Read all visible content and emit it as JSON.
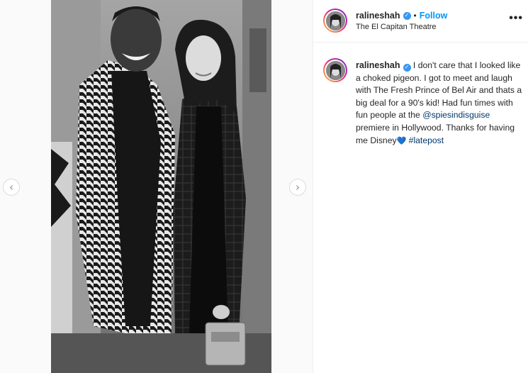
{
  "post": {
    "username": "ralineshah",
    "follow_label": "Follow",
    "separator": "•",
    "location": "The El Capitan Theatre",
    "more_label": "•••"
  },
  "caption": {
    "username": "ralineshah",
    "text_1": " I don't care that I looked like a choked pigeon. I got to meet and laugh with The Fresh Prince of Bel Air and thats a big deal for a 90's kid! Had fun times with fun people at the ",
    "mention": "@spiesindisguise",
    "text_2": " premiere in Hollywood. Thanks for having me Disney",
    "emoji": "💙",
    "hashtag": "#latepost"
  },
  "icons": {
    "verified": "verified-badge-icon",
    "prev": "chevron-left-icon",
    "next": "chevron-right-icon",
    "more": "more-options-icon",
    "heart": "blue-heart-emoji"
  },
  "glyphs": {
    "verified": "✓",
    "prev": "‹",
    "next": "›"
  },
  "colors": {
    "accent": "#0095f6",
    "link": "#00376b",
    "verified": "#3897f0"
  }
}
